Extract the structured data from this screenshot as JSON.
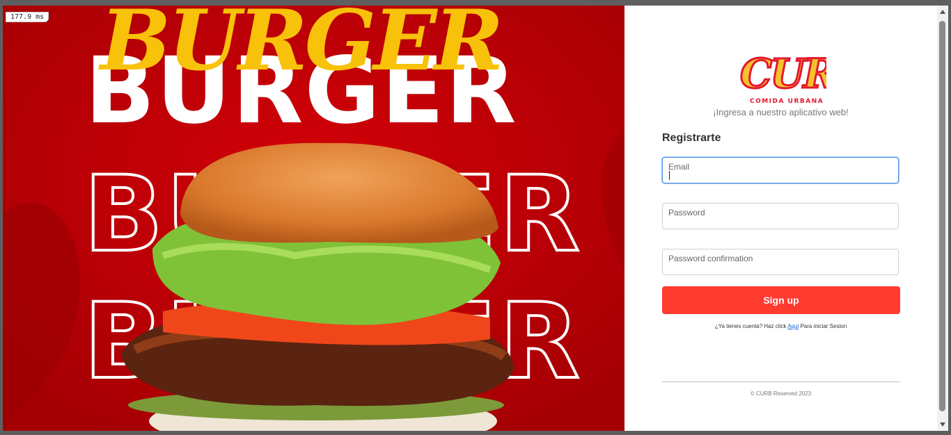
{
  "hero": {
    "script_text": "BURGER",
    "headline": "BURGER",
    "outline_text_1": "BURGER",
    "outline_text_2": "BURGER"
  },
  "perf_overlay": "177.9 ms",
  "brand": {
    "logo_text": "CURB",
    "logo_sub": "COMIDA URBANA",
    "tagline": "¡Ingresa a nuestro aplicativo web!"
  },
  "form": {
    "title": "Registrarte",
    "email_label": "Email",
    "email_value": "",
    "password_label": "Password",
    "password_value": "",
    "confirm_label": "Password confirmation",
    "confirm_value": "",
    "submit_label": "Sign up"
  },
  "login_prompt": {
    "before": "¿Ya tienes cuenta? Haz click ",
    "link": "Aqui",
    "after": " Para iniciar Sesion"
  },
  "footer": "© CURB Reserved 2023",
  "colors": {
    "hero_red": "#c10006",
    "button_red": "#ff3b30",
    "logo_yellow": "#f6c22b",
    "logo_red": "#e3172e"
  }
}
